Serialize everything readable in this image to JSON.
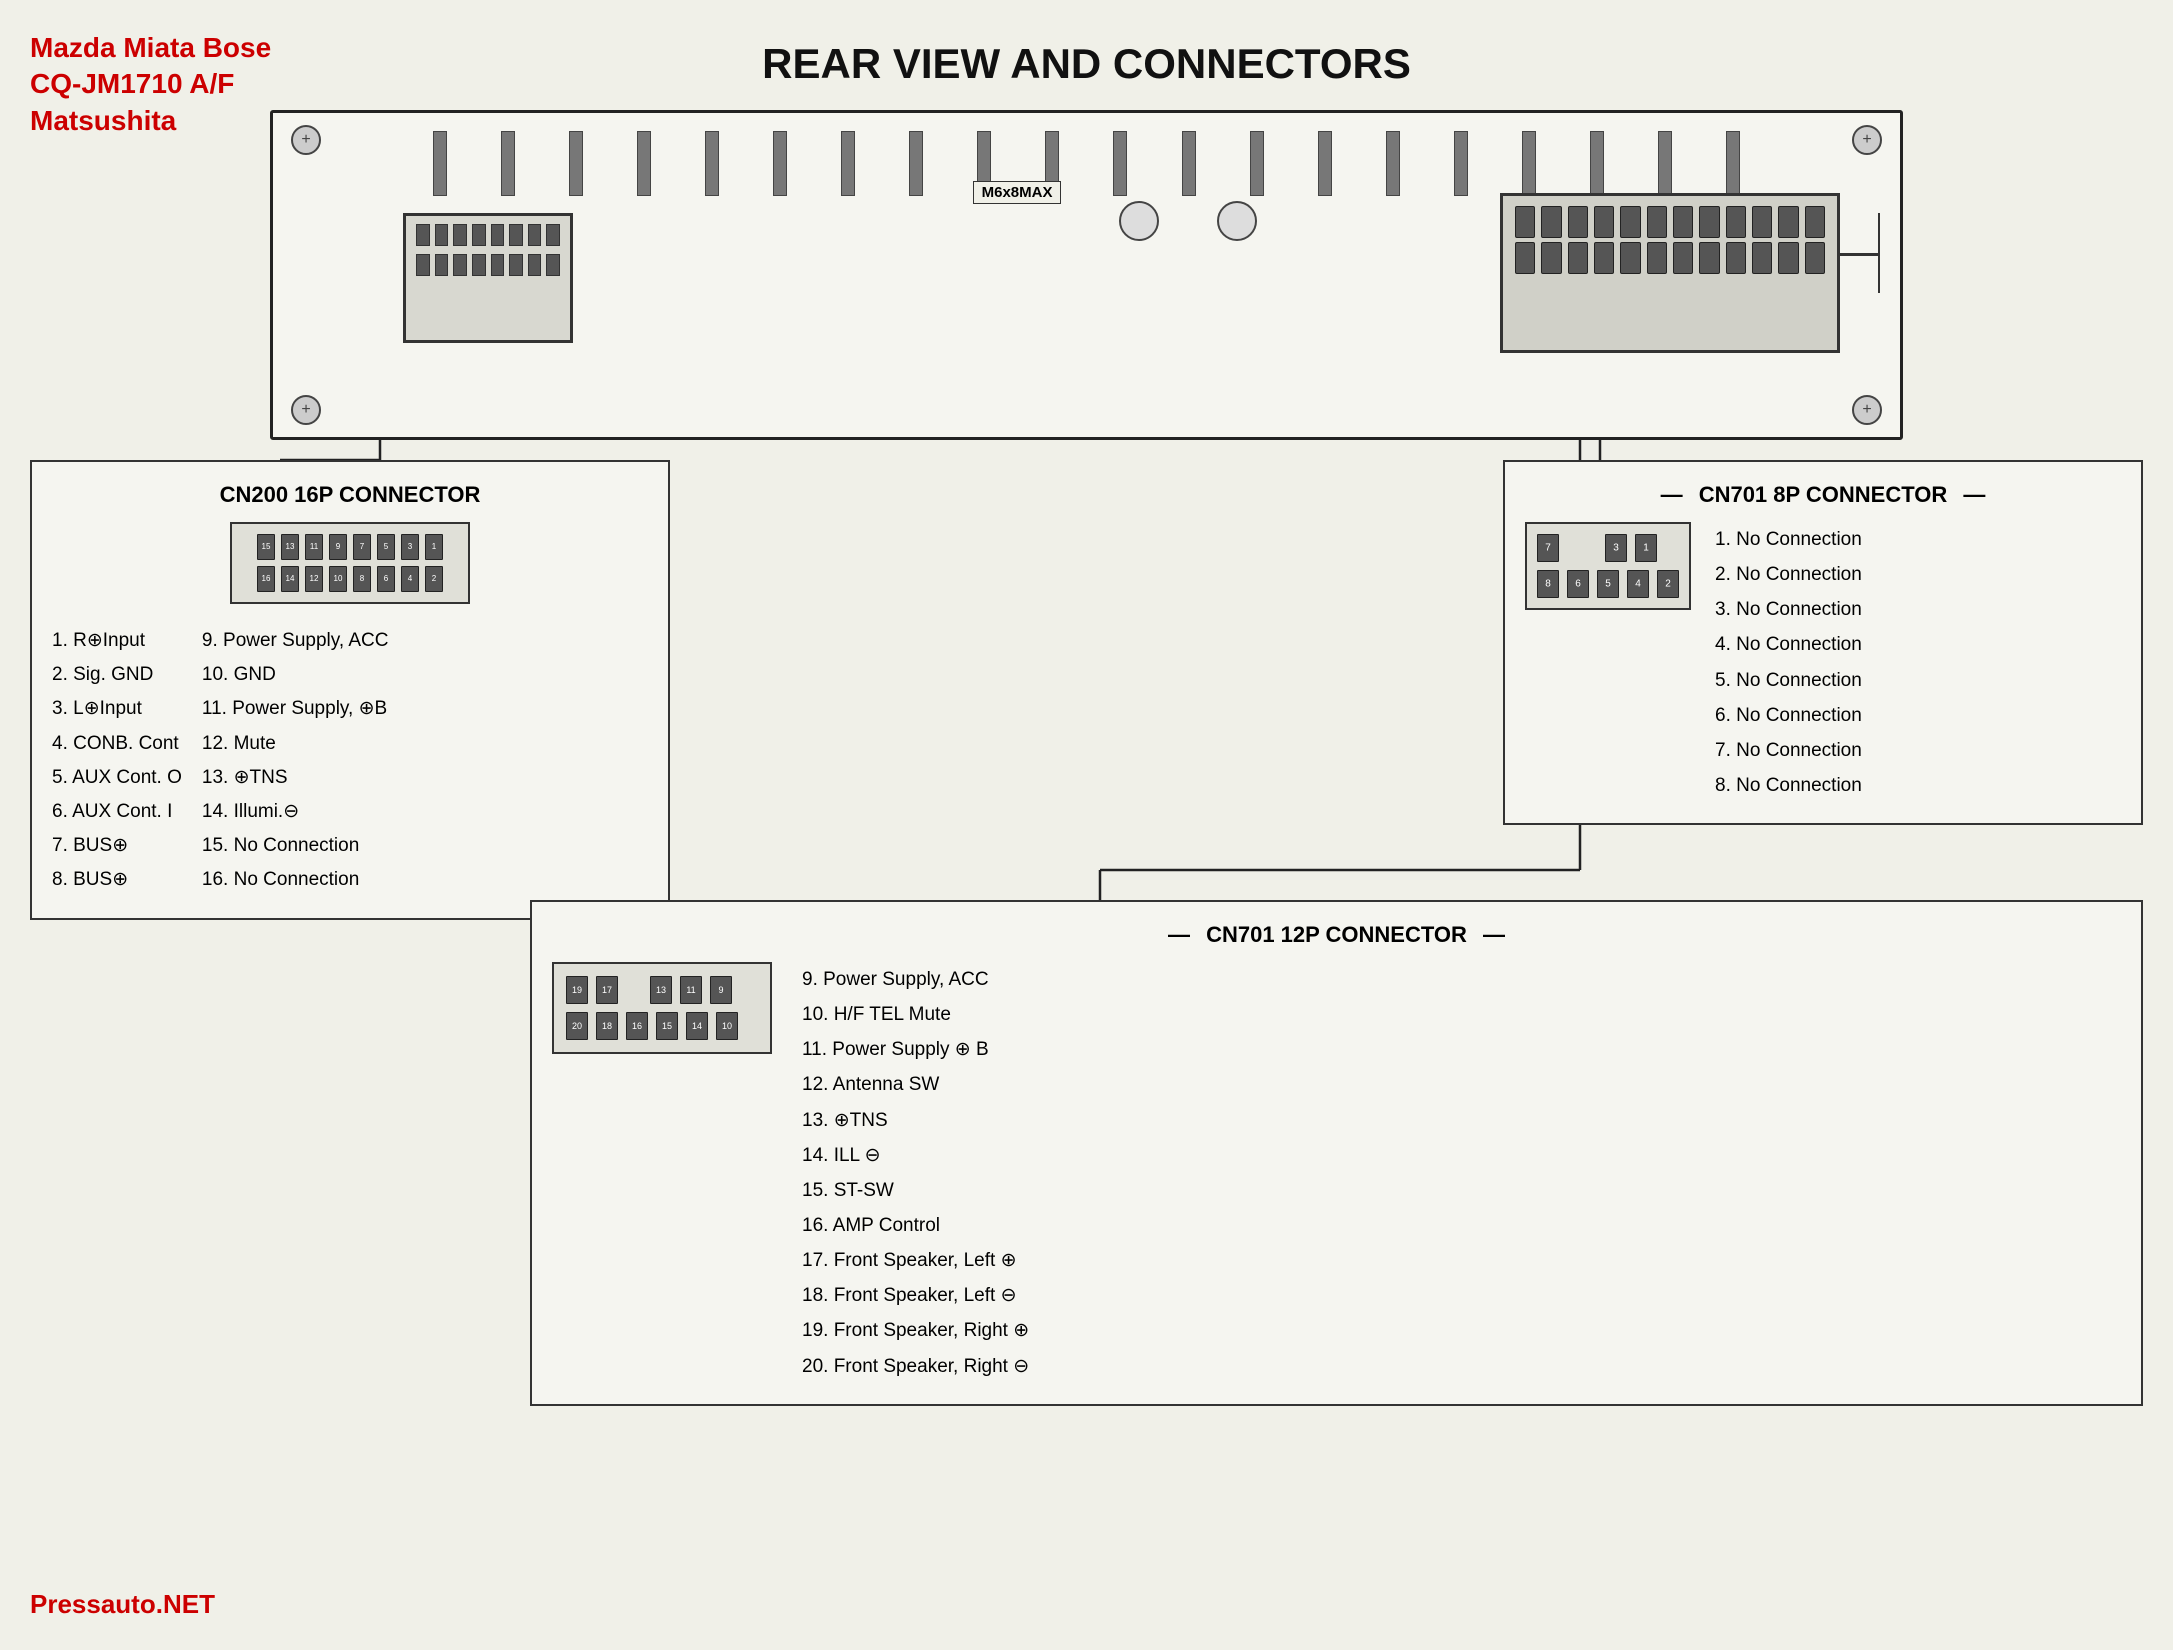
{
  "header": {
    "title_line1": "Mazda Miata Bose",
    "title_line2": "CQ-JM1710 A/F",
    "title_line3": "Matsushita",
    "main_title": "REAR VIEW AND CONNECTORS",
    "url": "Pressauto.NET"
  },
  "unit": {
    "label": "M6x8MAX"
  },
  "cn200": {
    "title": "CN200 16P CONNECTOR",
    "pin_rows_top": [
      "15",
      "13",
      "11",
      "9",
      "7",
      "5",
      "3",
      "1"
    ],
    "pin_rows_bottom": [
      "16",
      "14",
      "12",
      "10",
      "8",
      "6",
      "4",
      "2"
    ],
    "pins": [
      {
        "num": "1.",
        "label": "R⊕Input"
      },
      {
        "num": "2.",
        "label": "Sig. GND"
      },
      {
        "num": "3.",
        "label": "L⊕Input"
      },
      {
        "num": "4.",
        "label": "CONB. Cont"
      },
      {
        "num": "5.",
        "label": "AUX Cont. O"
      },
      {
        "num": "6.",
        "label": "AUX Cont. I"
      },
      {
        "num": "7.",
        "label": "BUS⊕"
      },
      {
        "num": "8.",
        "label": "BUS⊕"
      },
      {
        "num": "9.",
        "label": "Power Supply, ACC"
      },
      {
        "num": "10.",
        "label": "GND"
      },
      {
        "num": "11.",
        "label": "Power Supply, ⊕B"
      },
      {
        "num": "12.",
        "label": "Mute"
      },
      {
        "num": "13.",
        "label": "⊕TNS"
      },
      {
        "num": "14.",
        "label": "Illumi.⊖"
      },
      {
        "num": "15.",
        "label": "No Connection"
      },
      {
        "num": "16.",
        "label": "No Connection"
      }
    ]
  },
  "cn701_8p": {
    "title": "CN701 8P CONNECTOR",
    "pin_rows_top": [
      "7",
      "3",
      "1"
    ],
    "pin_rows_bottom": [
      "8",
      "6",
      "5",
      "4",
      "2"
    ],
    "pins": [
      {
        "num": "1.",
        "label": "No Connection"
      },
      {
        "num": "2.",
        "label": "No Connection"
      },
      {
        "num": "3.",
        "label": "No Connection"
      },
      {
        "num": "4.",
        "label": "No Connection"
      },
      {
        "num": "5.",
        "label": "No Connection"
      },
      {
        "num": "6.",
        "label": "No Connection"
      },
      {
        "num": "7.",
        "label": "No Connection"
      },
      {
        "num": "8.",
        "label": "No Connection"
      }
    ]
  },
  "cn701_12p": {
    "title": "CN701 12P CONNECTOR",
    "pin_rows_top": [
      "19",
      "17",
      "13",
      "11",
      "9"
    ],
    "pin_rows_bottom": [
      "20",
      "18",
      "16",
      "15",
      "14",
      "10"
    ],
    "pins": [
      {
        "num": "9.",
        "label": "Power Supply, ACC"
      },
      {
        "num": "10.",
        "label": "H/F TEL Mute"
      },
      {
        "num": "11.",
        "label": "Power Supply ⊕ B"
      },
      {
        "num": "12.",
        "label": "Antenna SW"
      },
      {
        "num": "13.",
        "label": "⊕TNS"
      },
      {
        "num": "14.",
        "label": "ILL ⊖"
      },
      {
        "num": "15.",
        "label": "ST-SW"
      },
      {
        "num": "16.",
        "label": "AMP Control"
      },
      {
        "num": "17.",
        "label": "Front Speaker, Left ⊕"
      },
      {
        "num": "18.",
        "label": "Front Speaker, Left ⊖"
      },
      {
        "num": "19.",
        "label": "Front Speaker, Right ⊕"
      },
      {
        "num": "20.",
        "label": "Front Speaker, Right ⊖"
      }
    ]
  }
}
